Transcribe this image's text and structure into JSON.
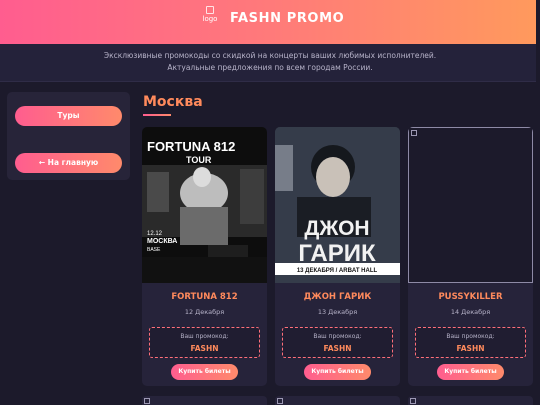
{
  "header": {
    "logo_alt": "logo",
    "brand": "FASHN PROMO"
  },
  "intro": {
    "line1": "Эксклюзивные промокоды со скидкой на концерты ваших любимых исполнителей.",
    "line2": "Актуальные предложения по всем городам России."
  },
  "sidebar": {
    "tours_label": "Туры",
    "home_label": "← На главную"
  },
  "city": "Москва",
  "cards": [
    {
      "artist": "FORTUNA 812",
      "date": "12 Декабря",
      "promo_label": "Ваш промокод:",
      "promo_code": "FASHN",
      "buy_label": "Купить билеты",
      "poster": {
        "title": "FORTUNA 812",
        "subtitle": "TOUR",
        "date": "12.12",
        "city": "МОСКВА",
        "venue": "BASE"
      }
    },
    {
      "artist": "ДЖОН ГАРИК",
      "date": "13 Декабря",
      "promo_label": "Ваш промокод:",
      "promo_code": "FASHN",
      "buy_label": "Купить билеты",
      "poster": {
        "line1": "ДЖОН",
        "line2": "ГАРИК",
        "banner": "13 ДЕКАБРЯ / ARBAT HALL"
      }
    },
    {
      "artist": "PUSSYKILLER",
      "date": "14 Декабря",
      "promo_label": "Ваш промокод:",
      "promo_code": "FASHN",
      "buy_label": "Купить билеты"
    }
  ],
  "colors": {
    "accent_start": "#ff5d8f",
    "accent_end": "#ff8a6b",
    "background": "#1c1a2b",
    "card": "#26233a",
    "artist_text": "#ff8a5c"
  },
  "icons": [
    "broken-image-icon",
    "arrow-left-icon"
  ]
}
